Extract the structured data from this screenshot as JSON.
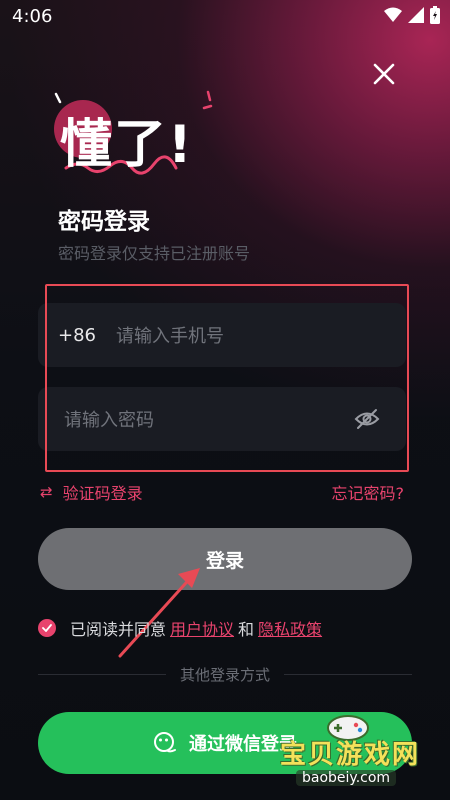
{
  "status_bar": {
    "time": "4:06"
  },
  "logo": {
    "text": "懂了!"
  },
  "header": {
    "title": "密码登录",
    "subtitle": "密码登录仅支持已注册账号"
  },
  "phone": {
    "prefix": "+86",
    "placeholder": "请输入手机号"
  },
  "password": {
    "placeholder": "请输入密码"
  },
  "links": {
    "sms_login": "验证码登录",
    "forgot": "忘记密码?"
  },
  "login_button": "登录",
  "agreement": {
    "prefix": "已阅读并同意",
    "user_agreement": "用户协议",
    "and": "和",
    "privacy_policy": "隐私政策"
  },
  "other_methods": "其他登录方式",
  "wechat_button": "通过微信登录",
  "watermark": {
    "text": "宝贝游戏网",
    "domain": "baobeiy.com"
  },
  "colors": {
    "accent": "#e8436d",
    "login_button": "#6e6f73",
    "wechat_button": "#25c05b",
    "highlight": "#e84a55"
  }
}
